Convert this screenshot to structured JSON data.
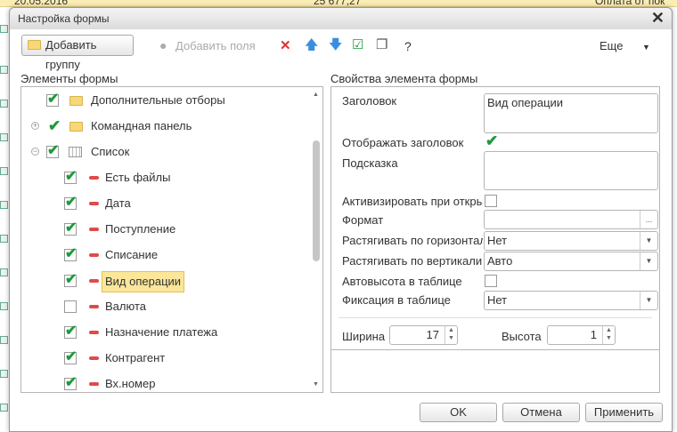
{
  "background": {
    "date": "20.05.2016",
    "amount": "25 677,27",
    "description": "Оплата от пок"
  },
  "dialog": {
    "title": "Настройка формы"
  },
  "toolbar": {
    "add_group": "Добавить группу",
    "add_fields": "Добавить поля",
    "help": "?",
    "more": "Еще"
  },
  "left": {
    "title": "Элементы формы",
    "items": [
      {
        "label": "Дополнительные отборы",
        "level": 0,
        "checked": true,
        "icon": "folder-icon"
      },
      {
        "label": "Командная панель",
        "level": 0,
        "checked": true,
        "icon": "folder-icon",
        "expander": "plus"
      },
      {
        "label": "Список",
        "level": 0,
        "checked": true,
        "icon": "table-icon",
        "expander": "minus"
      },
      {
        "label": "Есть файлы",
        "level": 1,
        "checked": true
      },
      {
        "label": "Дата",
        "level": 1,
        "checked": true
      },
      {
        "label": "Поступление",
        "level": 1,
        "checked": true
      },
      {
        "label": "Списание",
        "level": 1,
        "checked": true
      },
      {
        "label": "Вид операции",
        "level": 1,
        "checked": true,
        "selected": true
      },
      {
        "label": "Валюта",
        "level": 1,
        "checked": false
      },
      {
        "label": "Назначение платежа",
        "level": 1,
        "checked": true
      },
      {
        "label": "Контрагент",
        "level": 1,
        "checked": true
      },
      {
        "label": "Вх.номер",
        "level": 1,
        "checked": true
      }
    ]
  },
  "right": {
    "title": "Свойства элемента формы",
    "caption_label": "Заголовок",
    "caption_value": "Вид операции",
    "show_caption_label": "Отображать заголовок",
    "show_caption": true,
    "tooltip_label": "Подсказка",
    "tooltip_value": "",
    "activate_label": "Активизировать при откры",
    "activate": false,
    "format_label": "Формат",
    "format_value": "",
    "format_btn": "...",
    "hstretch_label": "Растягивать по горизонтал",
    "hstretch_value": "Нет",
    "vstretch_label": "Растягивать по вертикали",
    "vstretch_value": "Авто",
    "autoheight_label": "Автовысота в таблице",
    "autoheight": false,
    "fix_label": "Фиксация в таблице",
    "fix_value": "Нет",
    "width_label": "Ширина",
    "width_value": "17",
    "height_label": "Высота",
    "height_value": "1"
  },
  "footer": {
    "ok": "OK",
    "cancel": "Отмена",
    "apply": "Применить"
  },
  "colors": {
    "check": "#1e9a3c",
    "selection": "#fbe69a",
    "delete": "#e03030",
    "arrow": "#3a8ee0"
  }
}
